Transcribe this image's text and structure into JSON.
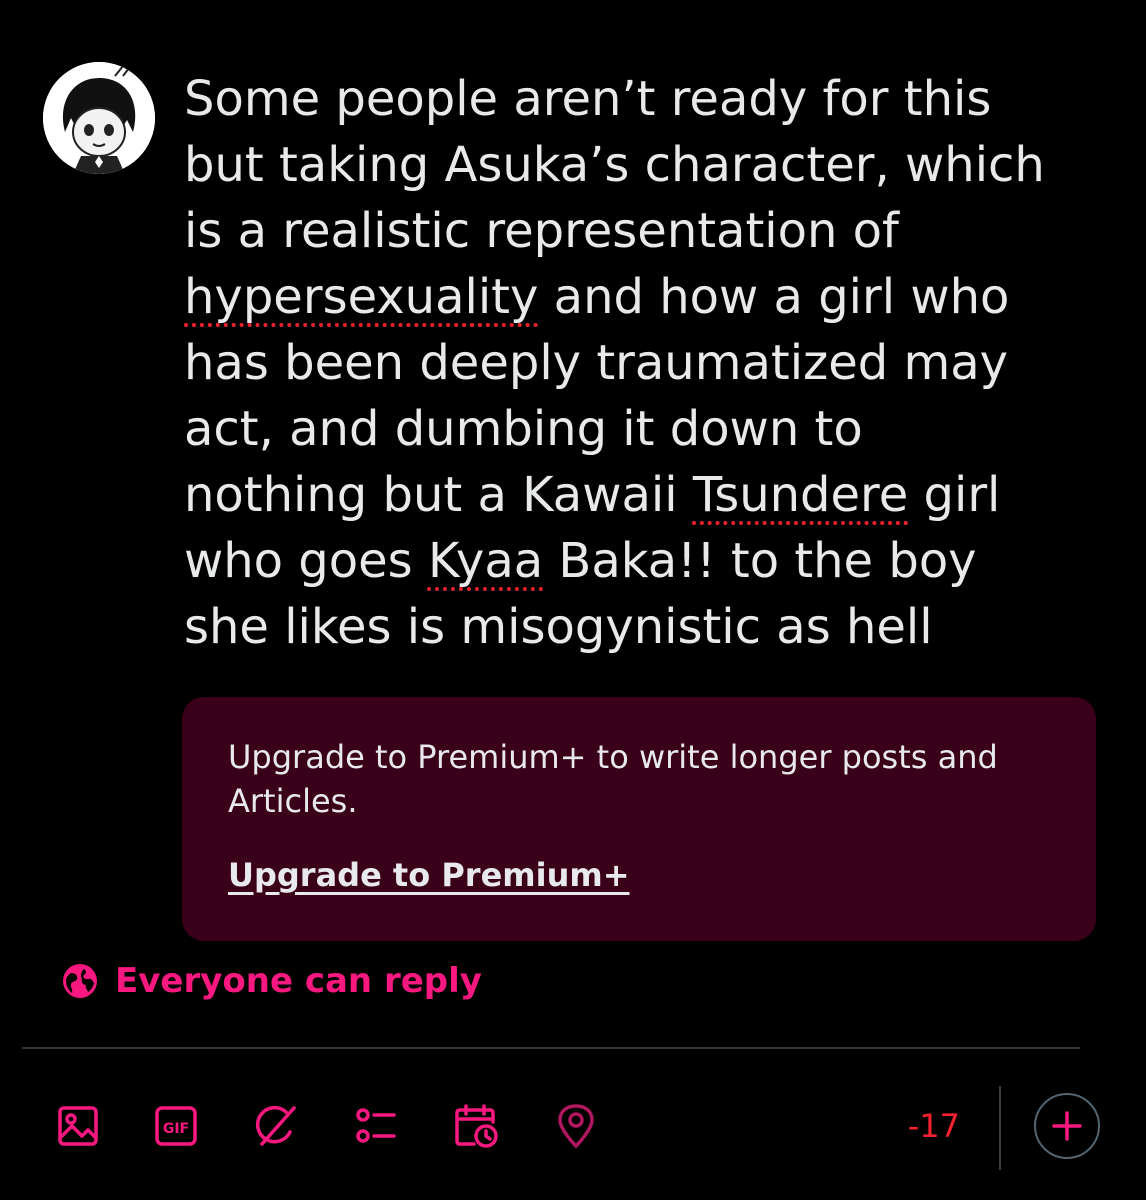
{
  "post": {
    "lines": [
      "Some people aren’t ready for this",
      "but taking Asuka’s character, which",
      "is a realistic representation of",
      "hypersexuality",
      " and how a girl who",
      "has been deeply traumatized may",
      "act, and dumbing it down to",
      "nothing but a Kawaii ",
      "Tsundere",
      " girl",
      "who goes ",
      "Kyaa",
      " Baka!! to the boy",
      "she likes is misogynistic as hell"
    ]
  },
  "premium": {
    "message": "Upgrade to Premium+ to write longer posts and Articles.",
    "link": "Upgrade to Premium+"
  },
  "reply_setting": {
    "label": "Everyone can reply",
    "icon": "globe-icon"
  },
  "toolbar": {
    "icons": [
      "image-icon",
      "gif-icon",
      "grok-icon",
      "poll-icon",
      "schedule-icon",
      "location-icon"
    ],
    "gif_text": "GIF"
  },
  "char_count": "-17",
  "add_icon": "plus-icon",
  "colors": {
    "accent": "#f91880",
    "error": "#f4212e",
    "text": "#e7e9ea",
    "premium_bg": "#3b0019",
    "background": "#000000"
  }
}
